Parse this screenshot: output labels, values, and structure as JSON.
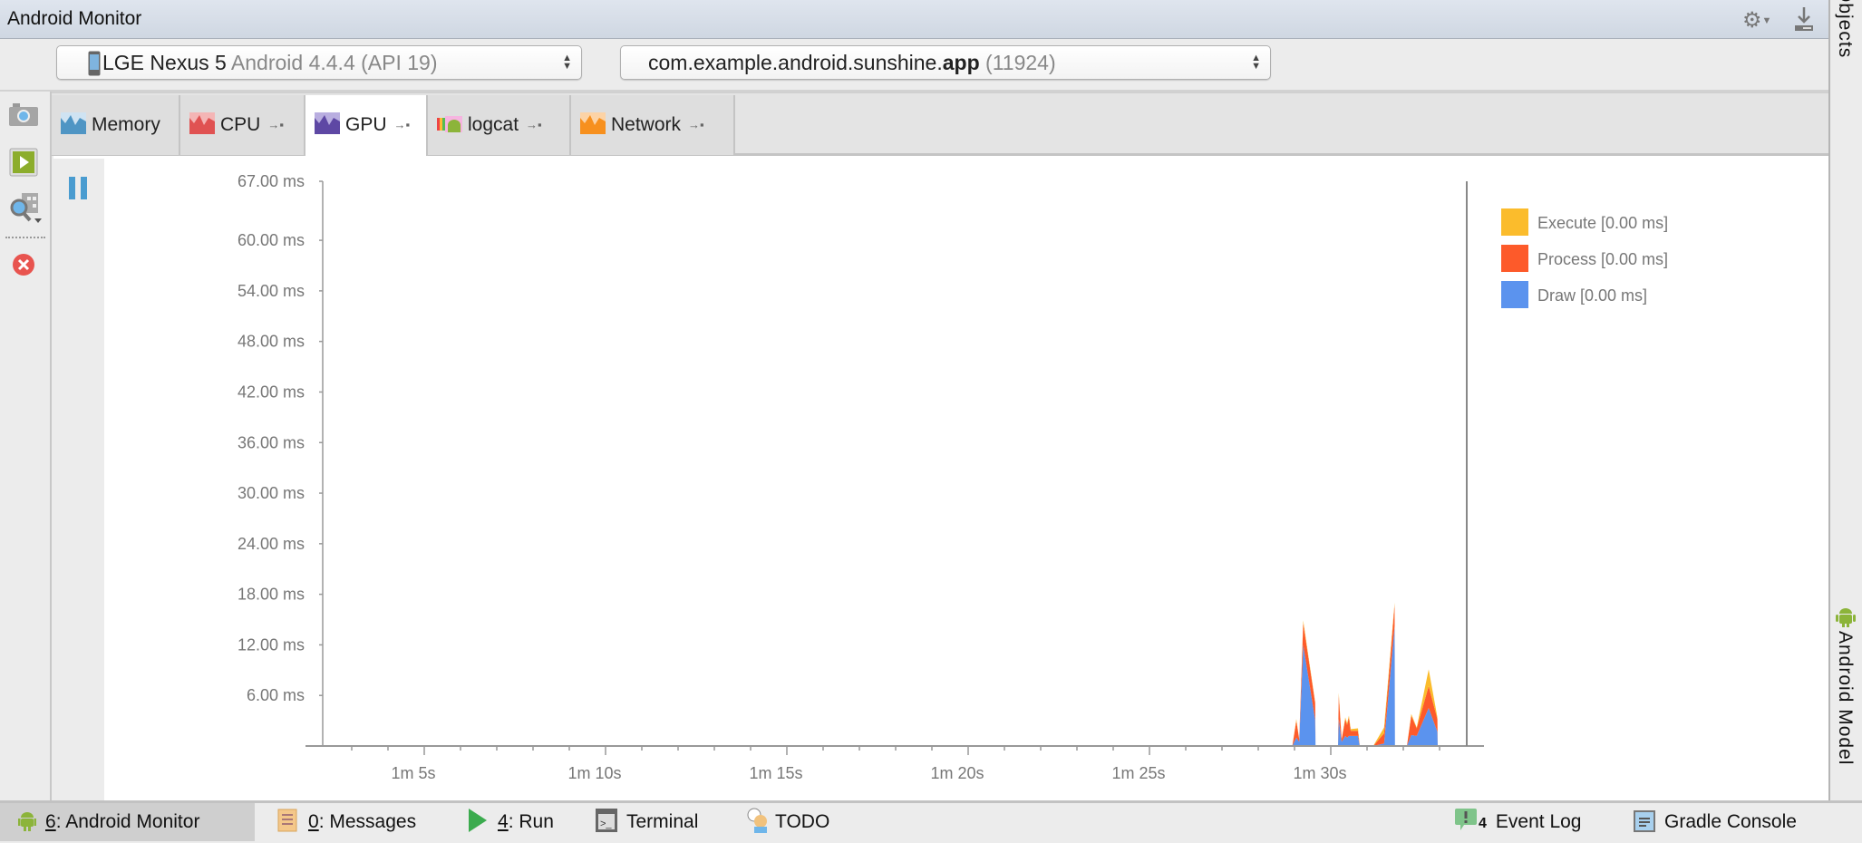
{
  "window": {
    "title": "Android Monitor",
    "right_sidebar_top": "Objects",
    "right_sidebar_bottom": "Android Model"
  },
  "toolbar_icons": [
    "gear-icon",
    "download-icon"
  ],
  "device_selector": {
    "device": "LGE Nexus 5",
    "os": "Android 4.4.4 (API 19)"
  },
  "process_selector": {
    "package_prefix": "com.example.android.sunshine.",
    "package_suffix": "app",
    "pid": "(11924)"
  },
  "left_tools": [
    "camera-icon",
    "start-method-tracing-icon",
    "inspect-icon",
    "terminate-icon"
  ],
  "tabs": [
    {
      "label": "Memory",
      "color": "#4f95c4"
    },
    {
      "label": "CPU",
      "color": "#e05252"
    },
    {
      "label": "GPU",
      "color": "#5e48a4",
      "active": true
    },
    {
      "label": "logcat",
      "color": "#8cb43a"
    },
    {
      "label": "Network",
      "color": "#f7901e"
    }
  ],
  "chart_data": {
    "type": "area",
    "stacked": true,
    "y_ticks": [
      "6.00 ms",
      "12.00 ms",
      "18.00 ms",
      "24.00 ms",
      "30.00 ms",
      "36.00 ms",
      "42.00 ms",
      "48.00 ms",
      "54.00 ms",
      "60.00 ms",
      "67.00 ms"
    ],
    "y_tick_values": [
      6,
      12,
      18,
      24,
      30,
      36,
      42,
      48,
      54,
      60,
      67
    ],
    "ylim": [
      0,
      67
    ],
    "x_unit": "seconds",
    "xlim": [
      61.7,
      93.75
    ],
    "x_ticks": [
      "1m 5s",
      "1m 10s",
      "1m 15s",
      "1m 20s",
      "1m 25s",
      "1m 30s"
    ],
    "x_tick_values": [
      65,
      70,
      75,
      80,
      85,
      90
    ],
    "grid": false,
    "legend_position": "right",
    "series": [
      {
        "name": "Draw",
        "legend": "Draw [0.00 ms]",
        "color": "#5b93ee"
      },
      {
        "name": "Process",
        "legend": "Process [0.00 ms]",
        "color": "#fd5a2a"
      },
      {
        "name": "Execute",
        "legend": "Execute [0.00 ms]",
        "color": "#fbbc2c"
      }
    ],
    "points": [
      {
        "t": 88.94,
        "draw": 0,
        "process": 0,
        "execute": 0
      },
      {
        "t": 89.05,
        "draw": 1.0,
        "process": 2.0,
        "execute": 0.2
      },
      {
        "t": 89.13,
        "draw": 0.5,
        "process": 0.3,
        "execute": 0
      },
      {
        "t": 89.24,
        "draw": 12.0,
        "process": 2.6,
        "execute": 0.3
      },
      {
        "t": 89.57,
        "draw": 3.1,
        "process": 2.0,
        "execute": 0.1
      },
      {
        "t": 89.58,
        "draw": 0,
        "process": 0,
        "execute": 0
      },
      {
        "t": 90.2,
        "draw": 0,
        "process": 0,
        "execute": 0
      },
      {
        "t": 90.22,
        "draw": 3.2,
        "process": 2.8,
        "execute": 0.3
      },
      {
        "t": 90.3,
        "draw": 0.5,
        "process": 0.3,
        "execute": 0
      },
      {
        "t": 90.4,
        "draw": 1.2,
        "process": 2.0,
        "execute": 0.2
      },
      {
        "t": 90.45,
        "draw": 1.0,
        "process": 1.5,
        "execute": 0.2
      },
      {
        "t": 90.5,
        "draw": 1.2,
        "process": 2.2,
        "execute": 0.2
      },
      {
        "t": 90.55,
        "draw": 1.2,
        "process": 0.6,
        "execute": 0.2
      },
      {
        "t": 90.75,
        "draw": 1.2,
        "process": 0.6,
        "execute": 0.3
      },
      {
        "t": 90.8,
        "draw": 0,
        "process": 0,
        "execute": 0
      },
      {
        "t": 91.17,
        "draw": 0,
        "process": 0,
        "execute": 0
      },
      {
        "t": 91.47,
        "draw": 0.3,
        "process": 1.2,
        "execute": 0.7
      },
      {
        "t": 91.76,
        "draw": 14.2,
        "process": 2.6,
        "execute": 0.2
      },
      {
        "t": 91.77,
        "draw": 0,
        "process": 0,
        "execute": 0
      },
      {
        "t": 92.1,
        "draw": 0,
        "process": 0,
        "execute": 0
      },
      {
        "t": 92.22,
        "draw": 1.3,
        "process": 2.3,
        "execute": 0.2
      },
      {
        "t": 92.37,
        "draw": 1.2,
        "process": 0.9,
        "execute": 0.1
      },
      {
        "t": 92.7,
        "draw": 4.5,
        "process": 2.6,
        "execute": 2.0
      },
      {
        "t": 92.94,
        "draw": 1.7,
        "process": 1.5,
        "execute": 0.2
      },
      {
        "t": 92.95,
        "draw": 0,
        "process": 0,
        "execute": 0
      }
    ]
  },
  "bottom_bar": {
    "android_monitor": {
      "key": "6",
      "label": ": Android Monitor"
    },
    "messages": {
      "key": "0",
      "label": ": Messages"
    },
    "run": {
      "key": "4",
      "label": ": Run"
    },
    "terminal": "Terminal",
    "todo": "TODO",
    "event_log_count": "4",
    "event_log": "Event Log",
    "gradle_console": "Gradle Console"
  }
}
